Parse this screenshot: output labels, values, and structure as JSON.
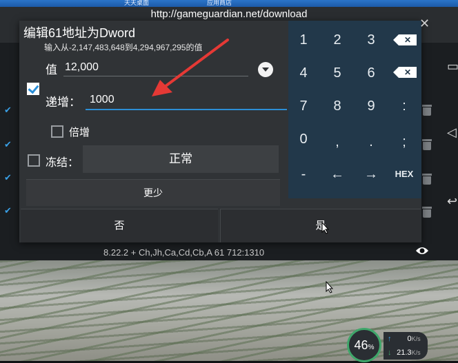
{
  "taskbar": {
    "tabs": [
      "",
      "天天桌面",
      "应用商店"
    ]
  },
  "browser": {
    "url": "http://gameguardian.net/download"
  },
  "dialog": {
    "title": "编辑61地址为Dword",
    "hint": "输入从-2,147,483,648到4,294,967,295的值",
    "value_label": "值",
    "value": "12,000",
    "increment_label": "递增：",
    "increment_value": "1000",
    "multiply_label": "倍增",
    "freeze_label": "冻结：",
    "freeze_mode": "正常",
    "less_label": "更少",
    "no_label": "否",
    "yes_label": "是"
  },
  "keypad": {
    "keys": [
      "1",
      "2",
      "3",
      "4",
      "5",
      "6",
      "7",
      "8",
      "9",
      ":",
      "0",
      ",",
      ".",
      ";",
      "-",
      "←",
      "→",
      "HEX"
    ]
  },
  "status": {
    "line": "8.22.2  +  Ch,Jh,Ca,Cd,Cb,A    61 712:1310"
  },
  "speed": {
    "percent": "46",
    "percent_unit": "%",
    "up": "0",
    "down": "21.3",
    "unit": "K/s"
  },
  "colors": {
    "accent": "#2c8fd6",
    "keypad_bg": "#22384a",
    "dialog_bg": "#303336",
    "arrow": "#e53935"
  },
  "icons": [
    "eye-icon",
    "backspace-icon",
    "dropdown-icon",
    "trash-icon",
    "check-icon"
  ]
}
